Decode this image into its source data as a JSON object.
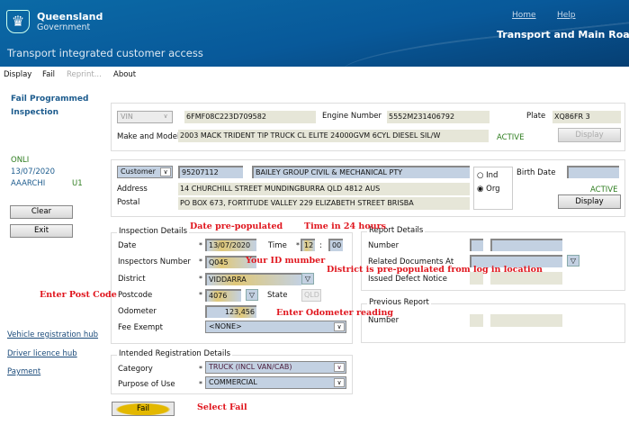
{
  "header": {
    "org_line1": "Queensland",
    "org_line2": "Government",
    "app_title": "Transport integrated customer access",
    "home": "Home",
    "help": "Help",
    "department": "Transport and Main Roads"
  },
  "menu": [
    "Display",
    "Fail",
    "Reprint...",
    "About"
  ],
  "left": {
    "title1": "Fail Programmed",
    "title2": "Inspection",
    "mode": "ONLI",
    "date": "13/07/2020",
    "user": "AAARCHI",
    "unit": "U1",
    "clear": "Clear",
    "exit": "Exit",
    "links": [
      "Vehicle registration hub",
      "Driver licence hub",
      "Payment"
    ]
  },
  "vehicle": {
    "id_type": "VIN",
    "vin": "6FMF08C223D709582",
    "engine_label": "Engine Number",
    "engine": "5552M231406792",
    "plate_label": "Plate",
    "plate": "XQ86FR 3",
    "make_label": "Make and Model",
    "make": "2003 MACK TRIDENT TIP TRUCK CL ELITE 24000GVM 6CYL DIESEL SIL/W",
    "status": "ACTIVE",
    "display": "Display"
  },
  "customer": {
    "type": "Customer",
    "number": "95207112",
    "name": "BAILEY GROUP CIVIL & MECHANICAL PTY",
    "radio_ind": "Ind",
    "radio_org": "Org",
    "selected": "Org",
    "birth_label": "Birth Date",
    "birth": "",
    "address_label": "Address",
    "address": "14 CHURCHILL STREET MUNDINGBURRA QLD 4812 AUS",
    "postal_label": "Postal",
    "postal": "PO BOX 673, FORTITUDE VALLEY 229 ELIZABETH STREET BRISBA",
    "status": "ACTIVE",
    "display": "Display"
  },
  "inspection": {
    "legend": "Inspection Details",
    "date_label": "Date",
    "date": "13/07/2020",
    "time_label": "Time",
    "hour": "12",
    "minute": "00",
    "inspector_label": "Inspectors Number",
    "inspector": "Q045",
    "district_label": "District",
    "district": "VIDDARRA",
    "postcode_label": "Postcode",
    "postcode": "4076",
    "state_label": "State",
    "state": "QLD",
    "odometer_label": "Odometer",
    "odometer": "123,456",
    "fee_label": "Fee Exempt",
    "fee": "<NONE>"
  },
  "report": {
    "legend": "Report Details",
    "number_label": "Number",
    "related_label": "Related Documents At",
    "defect_label": "Issued Defect Notice"
  },
  "previous": {
    "legend": "Previous Report",
    "number_label": "Number"
  },
  "registration": {
    "legend": "Intended Registration Details",
    "category_label": "Category",
    "category": "TRUCK (INCL VAN/CAB)",
    "purpose_label": "Purpose of Use",
    "purpose": "COMMERCIAL"
  },
  "fail_button": "Fail",
  "annotations": {
    "date": "Date pre-populated",
    "time": "Time in 24 hours",
    "id": "Your ID mumber",
    "district": "District is pre-populated from log in location",
    "postcode": "Enter Post Code",
    "odometer": "Enter Odometer reading",
    "fail": "Select Fail"
  }
}
